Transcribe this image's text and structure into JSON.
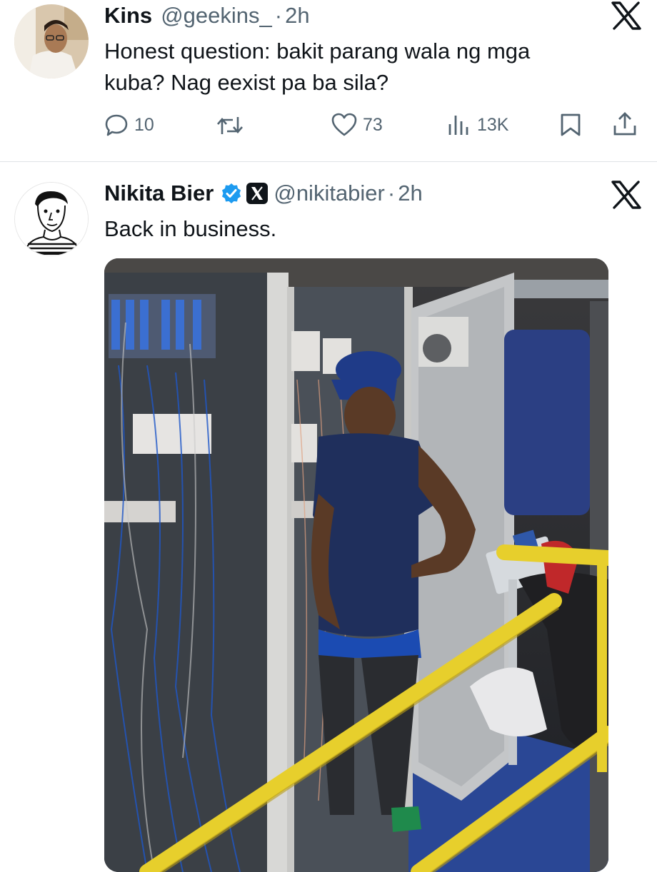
{
  "tweets": [
    {
      "author_name": "Kins",
      "handle": "@geekins_",
      "separator": "·",
      "time": "2h",
      "text_line1": "Honest question: bakit parang wala ng mga",
      "text_line2": "kuba? Nag eexist pa ba sila?",
      "replies": "10",
      "likes": "73",
      "views": "13K",
      "platform_icon": "x-logo-icon"
    },
    {
      "author_name": "Nikita Bier",
      "handle": "@nikitabier",
      "separator": "·",
      "time": "2h",
      "text": "Back in business.",
      "verified": true,
      "affiliate_badge": "x-affiliate-icon",
      "media_description_icon": "photo-icon",
      "platform_icon": "x-logo-icon"
    }
  ],
  "colors": {
    "text_primary": "#0f1419",
    "text_secondary": "#536471",
    "verified_blue": "#1d9bf0",
    "divider": "#dfe3e6"
  }
}
